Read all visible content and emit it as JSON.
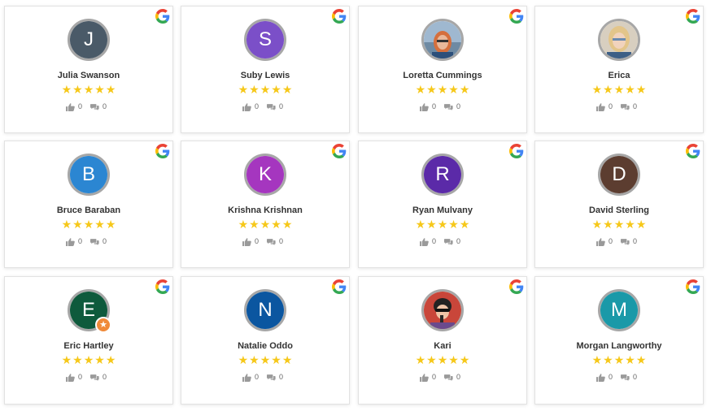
{
  "reviews": [
    {
      "name": "Julia Swanson",
      "initial": "J",
      "avatar_color": "#4a5a68",
      "photo": false,
      "badge": false,
      "rating": 5,
      "likes": "0",
      "comments": "0"
    },
    {
      "name": "Suby Lewis",
      "initial": "S",
      "avatar_color": "#7b4fc8",
      "photo": false,
      "badge": false,
      "rating": 5,
      "likes": "0",
      "comments": "0"
    },
    {
      "name": "Loretta Cummings",
      "initial": "",
      "avatar_color": "#8aa7c2",
      "photo": true,
      "badge": false,
      "rating": 5,
      "likes": "0",
      "comments": "0"
    },
    {
      "name": "Erica",
      "initial": "",
      "avatar_color": "#c9b79a",
      "photo": true,
      "badge": false,
      "rating": 5,
      "likes": "0",
      "comments": "0"
    },
    {
      "name": "Bruce Baraban",
      "initial": "B",
      "avatar_color": "#2b86d2",
      "photo": false,
      "badge": false,
      "rating": 5,
      "likes": "0",
      "comments": "0"
    },
    {
      "name": "Krishna Krishnan",
      "initial": "K",
      "avatar_color": "#a536bf",
      "photo": false,
      "badge": false,
      "rating": 5,
      "likes": "0",
      "comments": "0"
    },
    {
      "name": "Ryan Mulvany",
      "initial": "R",
      "avatar_color": "#5b2aa8",
      "photo": false,
      "badge": false,
      "rating": 5,
      "likes": "0",
      "comments": "0"
    },
    {
      "name": "David Sterling",
      "initial": "D",
      "avatar_color": "#5c3d30",
      "photo": false,
      "badge": false,
      "rating": 5,
      "likes": "0",
      "comments": "0"
    },
    {
      "name": "Eric Hartley",
      "initial": "E",
      "avatar_color": "#0e5a3c",
      "photo": false,
      "badge": true,
      "rating": 5,
      "likes": "0",
      "comments": "0"
    },
    {
      "name": "Natalie Oddo",
      "initial": "N",
      "avatar_color": "#0b56a0",
      "photo": false,
      "badge": false,
      "rating": 5,
      "likes": "0",
      "comments": "0"
    },
    {
      "name": "Kari",
      "initial": "",
      "avatar_color": "#c9463a",
      "photo": true,
      "badge": false,
      "rating": 5,
      "likes": "0",
      "comments": "0"
    },
    {
      "name": "Morgan Langworthy",
      "initial": "M",
      "avatar_color": "#1a99a8",
      "photo": false,
      "badge": false,
      "rating": 5,
      "likes": "0",
      "comments": "0"
    }
  ],
  "icons": {
    "source": "google-icon",
    "like": "thumbs-up-icon",
    "comment": "comment-icon",
    "star": "star-icon"
  },
  "colors": {
    "star": "#f6c81a",
    "card_border": "#e2e2e2",
    "name_text": "#333333",
    "meta_text": "#666666"
  }
}
